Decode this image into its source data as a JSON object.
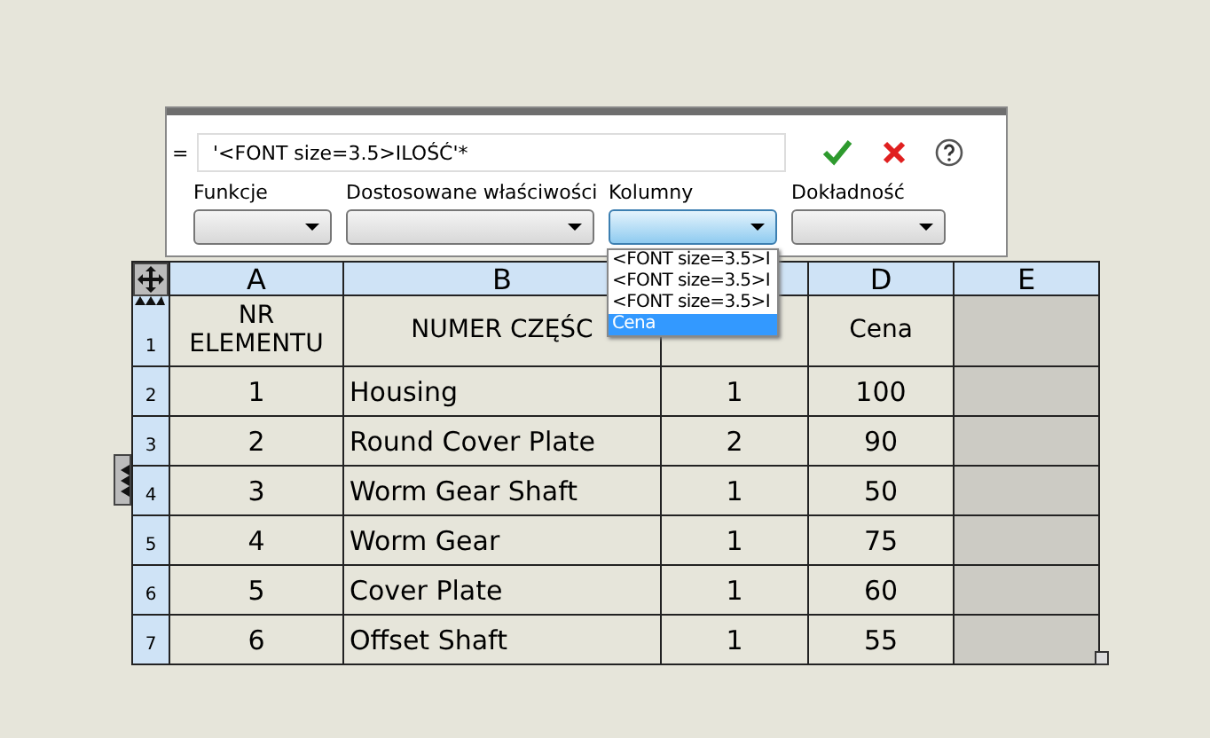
{
  "formula_bar": {
    "prefix": "=",
    "value": "'<FONT size=3.5>ILOŚĆ'*"
  },
  "dropdowns": [
    {
      "label": "Funkcje",
      "open": false
    },
    {
      "label": "Dostosowane właściwości",
      "open": false
    },
    {
      "label": "Kolumny",
      "open": true
    },
    {
      "label": "Dokładność",
      "open": false
    }
  ],
  "dropdown_list": [
    {
      "text": "<FONT size=3.5>I",
      "selected": false
    },
    {
      "text": "<FONT size=3.5>I",
      "selected": false
    },
    {
      "text": "<FONT size=3.5>I",
      "selected": false
    },
    {
      "text": "Cena",
      "selected": true
    }
  ],
  "table": {
    "columns": [
      {
        "label": "A"
      },
      {
        "label": "B"
      },
      {},
      {
        "label": "D"
      },
      {
        "label": "E"
      }
    ],
    "rows": [
      {
        "number": "1",
        "cells": [
          "NR ELEMENTU",
          "NUMER CZĘŚC",
          null,
          "Cena",
          null
        ]
      },
      {
        "number": "2",
        "cells": [
          "1",
          "Housing",
          "1",
          "100",
          null
        ]
      },
      {
        "number": "3",
        "cells": [
          "2",
          "Round Cover Plate",
          "2",
          "90",
          null
        ]
      },
      {
        "number": "4",
        "cells": [
          "3",
          "Worm Gear Shaft",
          "1",
          "50",
          null
        ]
      },
      {
        "number": "5",
        "cells": [
          "4",
          "Worm Gear",
          "1",
          "75",
          null
        ]
      },
      {
        "number": "6",
        "cells": [
          "5",
          "Cover Plate",
          "1",
          "60",
          null
        ]
      },
      {
        "number": "7",
        "cells": [
          "6",
          "Offset Shaft",
          "1",
          "55",
          null
        ]
      }
    ]
  }
}
